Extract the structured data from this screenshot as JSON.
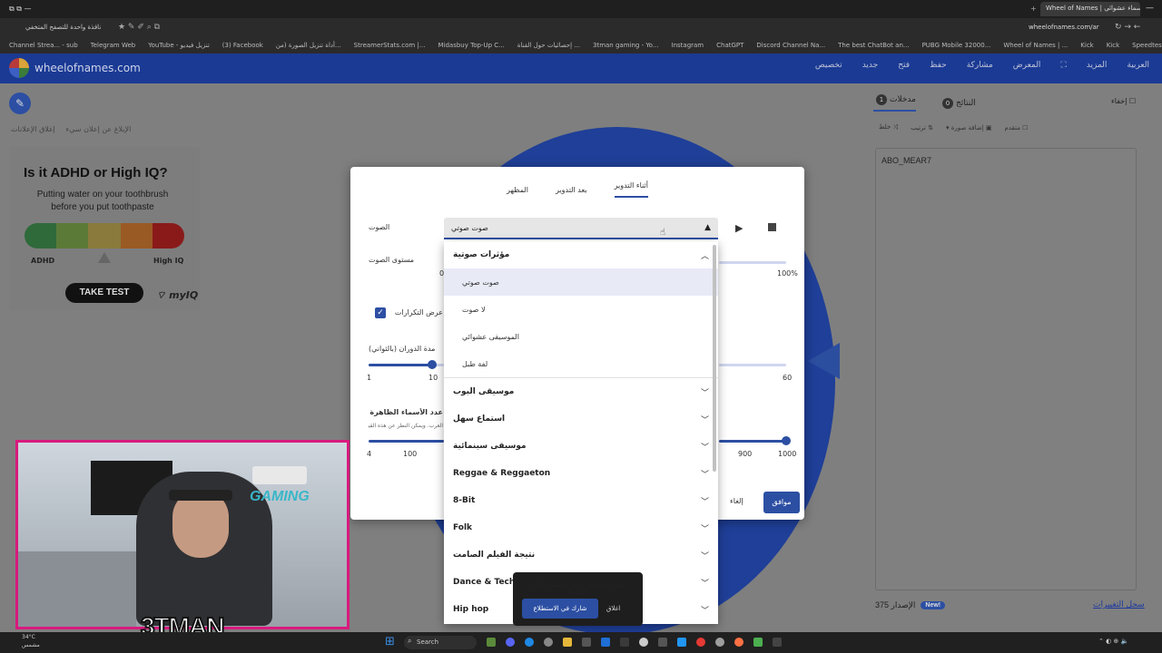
{
  "browser": {
    "tabs": [
      "نافذة واحدة للتصفح المتخفي",
      "Wheel of Names | عجلة الأسماء - مولد أسماء عشوائي"
    ],
    "url": "wheelofnames.com/ar",
    "bookmarks": [
      "Channel Strea... - sub",
      "Telegram Web",
      "YouTube - تنزيل فيديو",
      "(3) Facebook",
      "أداة تنزيل الصورة (من...",
      "StreamerStats.com |...",
      "Midasbuy Top-Up C...",
      "إحصائيات حول القناة ...",
      "3tman gaming - Yo...",
      "Instagram",
      "ChatGPT",
      "Discord Channel Na...",
      "The best ChatBot an...",
      "PUBG Mobile 32000...",
      "Wheel of Names | ...",
      "Kick",
      "Kick",
      "Speedtest by Ookla...",
      "Google"
    ]
  },
  "header": {
    "logo_text": "wheelofnames.com",
    "menu": [
      "العربية",
      "المزيد",
      "",
      "المعرض",
      "مشاركة",
      "حفظ",
      "فتح",
      "جديد",
      "تخصيص"
    ]
  },
  "ad": {
    "report": "الإبلاغ عن إعلان سيء",
    "close": "إغلاق الإعلانات",
    "title": "Is it ADHD or High IQ?",
    "subtitle": "Putting water on your toothbrush before you put toothpaste",
    "left_label": "ADHD",
    "right_label": "High IQ",
    "button": "TAKE TEST",
    "brand": "myIQ"
  },
  "right_panel": {
    "hide_label": "إخفاء",
    "tab_entries": "مدخلات",
    "entries_count": "1",
    "tab_results": "النتائج",
    "results_count": "0",
    "tools": [
      "خلط",
      "ترتيب",
      "إضافة صورة",
      "متقدم"
    ],
    "entries": "ABO_MEAR7",
    "version_label": "الإصدار 375",
    "new_badge": "New!",
    "changelog": "سجل التغييرات"
  },
  "modal": {
    "tabs": [
      "أثناء التدوير",
      "بعد التدوير",
      "المظهر"
    ],
    "sound_label": "الصوت",
    "sound_value": "صوت صوتي",
    "volume_label": "مستوى الصوت",
    "volume_min": "0",
    "volume_max": "100%",
    "show_repeats": "عرض التكرارات",
    "spin_time_label": "مدة الدوران (بالثواني)",
    "spin_min": "1",
    "spin_mid": "10",
    "spin_max": "60",
    "names_label": "عدد الأسماء الظاهرة على العجلة",
    "names_hint": "العرب. ويمكن النظر عن هذه القيمة",
    "names_ticks": [
      "4",
      "100",
      "900",
      "1000"
    ],
    "ok": "موافق",
    "cancel": "إلغاء"
  },
  "dropdown": {
    "group_open": "مؤثرات صوتية",
    "items": [
      "صوت صوتي",
      "لا صوت",
      "الموسيقى عشوائي",
      "لفة طبل"
    ],
    "groups": [
      "موسيقى البوب",
      "استماع سهل",
      "موسيقى سينمائية",
      "Reggae & Reggaeton",
      "8-Bit",
      "Folk",
      "نتيجة الفيلم الصامت",
      "Dance & Techno",
      "Hip hop"
    ]
  },
  "survey": {
    "question": "هل تريد التفكير على مخطط الألوان الجديد؟",
    "button": "شارك في الاستطلاع",
    "close": "اغلاق"
  },
  "webcam": {
    "name": "3TMAN",
    "gaming": "GAMING"
  },
  "taskbar": {
    "search": "Search",
    "weather": "34°C",
    "weather_sub": "مشمس"
  },
  "colors": {
    "header": "#1a3a94",
    "accent": "#2c4fa3",
    "cam_border": "#d81a7e"
  }
}
